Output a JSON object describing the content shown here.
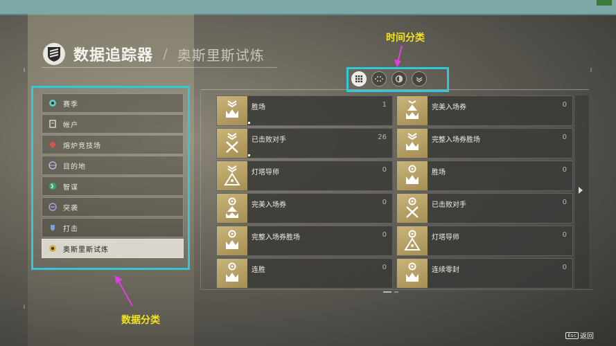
{
  "header": {
    "title": "数据追踪器",
    "separator": "/",
    "subtitle": "奥斯里斯试炼"
  },
  "annotations": {
    "time_category": "时间分类",
    "data_category": "数据分类"
  },
  "topbar": {
    "tag": ""
  },
  "sidebar": {
    "items": [
      {
        "label": "赛季",
        "icon": "season-icon",
        "active": false
      },
      {
        "label": "帐户",
        "icon": "account-icon",
        "active": false
      },
      {
        "label": "熔炉竞技场",
        "icon": "crucible-icon",
        "active": false
      },
      {
        "label": "目的地",
        "icon": "destination-icon",
        "active": false
      },
      {
        "label": "智谋",
        "icon": "gambit-icon",
        "active": false
      },
      {
        "label": "突袭",
        "icon": "raid-icon",
        "active": false
      },
      {
        "label": "打击",
        "icon": "strike-icon",
        "active": false
      },
      {
        "label": "奥斯里斯试炼",
        "icon": "trials-icon",
        "active": true
      }
    ]
  },
  "time_filters": [
    {
      "icon": "all-time-grid-icon",
      "active": true
    },
    {
      "icon": "season-dots-icon",
      "active": false
    },
    {
      "icon": "weekly-icon",
      "active": false
    },
    {
      "icon": "daily-wings-icon",
      "active": false
    }
  ],
  "stats": [
    {
      "name": "胜场",
      "value": "1",
      "emblem": "crown-chevrons"
    },
    {
      "name": "完美入场券",
      "value": "0",
      "emblem": "crown-pyramid"
    },
    {
      "name": "已击败对手",
      "value": "26",
      "emblem": "swords-chevrons"
    },
    {
      "name": "完整入场券胜场",
      "value": "0",
      "emblem": "crown-chevrons"
    },
    {
      "name": "灯塔导师",
      "value": "0",
      "emblem": "pyramid-chevrons"
    },
    {
      "name": "胜场",
      "value": "0",
      "emblem": "crown-eye"
    },
    {
      "name": "完美入场券",
      "value": "0",
      "emblem": "pyramid-eye"
    },
    {
      "name": "已击败对手",
      "value": "0",
      "emblem": "swords-eye"
    },
    {
      "name": "完整入场券胜场",
      "value": "0",
      "emblem": "crown-eye"
    },
    {
      "name": "灯塔导师",
      "value": "0",
      "emblem": "pyramid-eye"
    },
    {
      "name": "连胜",
      "value": "0",
      "emblem": "crown-eye"
    },
    {
      "name": "连续零封",
      "value": "0",
      "emblem": "crown-eye"
    }
  ],
  "footer": {
    "back_key": "Esc",
    "back_label": "返回"
  },
  "colors": {
    "annotation_box": "#2fc9d8",
    "annotation_text": "#f3e31b",
    "arrow": "#e040e0",
    "emblem_gold": "#b8a266"
  }
}
